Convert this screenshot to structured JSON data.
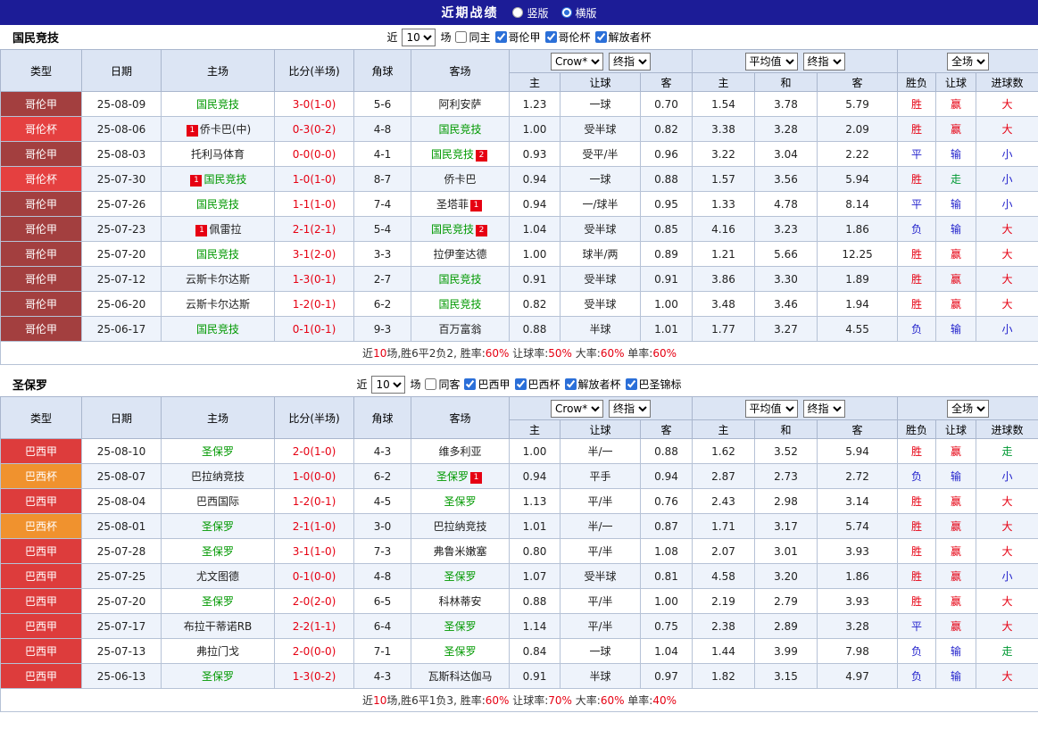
{
  "topbar": {
    "title": "近期战绩",
    "radios": [
      {
        "label": "竖版",
        "selected": false
      },
      {
        "label": "横版",
        "selected": true
      }
    ]
  },
  "colors": {
    "league": {
      "哥伦甲": "#a33f3f",
      "哥伦杯": "#e54040",
      "巴西甲": "#dd3c3c",
      "巴西杯": "#f0922e"
    },
    "result": {
      "red": "#e60012",
      "blue": "#2222cc",
      "green": "#009933"
    },
    "team": "#009900",
    "opponent": "#222222",
    "score": "#e60012",
    "summary_dark": "#333333"
  },
  "table_header": {
    "type": "类型",
    "date": "日期",
    "home": "主场",
    "score": "比分(半场)",
    "corner": "角球",
    "away": "客场",
    "odds1_selects": [
      "Crow*",
      "终指"
    ],
    "odds1_cols": [
      "主",
      "让球",
      "客"
    ],
    "odds2_selects": [
      "平均值",
      "终指"
    ],
    "odds2_cols": [
      "主",
      "和",
      "客"
    ],
    "result_select": "全场",
    "result_cols": [
      "胜负",
      "让球",
      "进球数"
    ]
  },
  "sections": [
    {
      "team": "国民竞技",
      "filter": {
        "prefix": "近",
        "games": "10",
        "suffix": "场",
        "checkboxes": [
          {
            "label": "同主",
            "checked": false
          },
          {
            "label": "哥伦甲",
            "checked": true
          },
          {
            "label": "哥伦杯",
            "checked": true
          },
          {
            "label": "解放者杯",
            "checked": true
          }
        ]
      },
      "rows": [
        {
          "league": "哥伦甲",
          "date": "25-08-09",
          "home": {
            "pre": "",
            "text": "国民竞技",
            "post": "",
            "team": true
          },
          "score": "3-0(1-0)",
          "corner": "5-6",
          "away": {
            "pre": "",
            "text": "阿利安萨",
            "post": "",
            "team": false
          },
          "odds1": [
            "1.23",
            "一球",
            "0.70"
          ],
          "odds2": [
            "1.54",
            "3.78",
            "5.79"
          ],
          "results": [
            [
              "胜",
              "red"
            ],
            [
              "赢",
              "red"
            ],
            [
              "大",
              "red"
            ]
          ]
        },
        {
          "league": "哥伦杯",
          "date": "25-08-06",
          "home": {
            "pre": "1",
            "text": "侨卡巴(中)",
            "post": "",
            "team": false
          },
          "score": "0-3(0-2)",
          "corner": "4-8",
          "away": {
            "pre": "",
            "text": "国民竞技",
            "post": "",
            "team": true
          },
          "odds1": [
            "1.00",
            "受半球",
            "0.82"
          ],
          "odds2": [
            "3.38",
            "3.28",
            "2.09"
          ],
          "results": [
            [
              "胜",
              "red"
            ],
            [
              "赢",
              "red"
            ],
            [
              "大",
              "red"
            ]
          ]
        },
        {
          "league": "哥伦甲",
          "date": "25-08-03",
          "home": {
            "pre": "",
            "text": "托利马体育",
            "post": "",
            "team": false
          },
          "score": "0-0(0-0)",
          "corner": "4-1",
          "away": {
            "pre": "",
            "text": "国民竞技",
            "post": "2",
            "team": true
          },
          "odds1": [
            "0.93",
            "受平/半",
            "0.96"
          ],
          "odds2": [
            "3.22",
            "3.04",
            "2.22"
          ],
          "results": [
            [
              "平",
              "blue"
            ],
            [
              "输",
              "blue"
            ],
            [
              "小",
              "blue"
            ]
          ]
        },
        {
          "league": "哥伦杯",
          "date": "25-07-30",
          "home": {
            "pre": "1",
            "text": "国民竞技",
            "post": "",
            "team": true
          },
          "score": "1-0(1-0)",
          "corner": "8-7",
          "away": {
            "pre": "",
            "text": "侨卡巴",
            "post": "",
            "team": false
          },
          "odds1": [
            "0.94",
            "一球",
            "0.88"
          ],
          "odds2": [
            "1.57",
            "3.56",
            "5.94"
          ],
          "results": [
            [
              "胜",
              "red"
            ],
            [
              "走",
              "green"
            ],
            [
              "小",
              "blue"
            ]
          ]
        },
        {
          "league": "哥伦甲",
          "date": "25-07-26",
          "home": {
            "pre": "",
            "text": "国民竞技",
            "post": "",
            "team": true
          },
          "score": "1-1(1-0)",
          "corner": "7-4",
          "away": {
            "pre": "",
            "text": "圣塔菲",
            "post": "1",
            "team": false
          },
          "odds1": [
            "0.94",
            "一/球半",
            "0.95"
          ],
          "odds2": [
            "1.33",
            "4.78",
            "8.14"
          ],
          "results": [
            [
              "平",
              "blue"
            ],
            [
              "输",
              "blue"
            ],
            [
              "小",
              "blue"
            ]
          ]
        },
        {
          "league": "哥伦甲",
          "date": "25-07-23",
          "home": {
            "pre": "1",
            "text": "佩雷拉",
            "post": "",
            "team": false
          },
          "score": "2-1(2-1)",
          "corner": "5-4",
          "away": {
            "pre": "",
            "text": "国民竞技",
            "post": "2",
            "team": true
          },
          "odds1": [
            "1.04",
            "受半球",
            "0.85"
          ],
          "odds2": [
            "4.16",
            "3.23",
            "1.86"
          ],
          "results": [
            [
              "负",
              "blue"
            ],
            [
              "输",
              "blue"
            ],
            [
              "大",
              "red"
            ]
          ]
        },
        {
          "league": "哥伦甲",
          "date": "25-07-20",
          "home": {
            "pre": "",
            "text": "国民竞技",
            "post": "",
            "team": true
          },
          "score": "3-1(2-0)",
          "corner": "3-3",
          "away": {
            "pre": "",
            "text": "拉伊奎达德",
            "post": "",
            "team": false
          },
          "odds1": [
            "1.00",
            "球半/两",
            "0.89"
          ],
          "odds2": [
            "1.21",
            "5.66",
            "12.25"
          ],
          "results": [
            [
              "胜",
              "red"
            ],
            [
              "赢",
              "red"
            ],
            [
              "大",
              "red"
            ]
          ]
        },
        {
          "league": "哥伦甲",
          "date": "25-07-12",
          "home": {
            "pre": "",
            "text": "云斯卡尔达斯",
            "post": "",
            "team": false
          },
          "score": "1-3(0-1)",
          "corner": "2-7",
          "away": {
            "pre": "",
            "text": "国民竞技",
            "post": "",
            "team": true
          },
          "odds1": [
            "0.91",
            "受半球",
            "0.91"
          ],
          "odds2": [
            "3.86",
            "3.30",
            "1.89"
          ],
          "results": [
            [
              "胜",
              "red"
            ],
            [
              "赢",
              "red"
            ],
            [
              "大",
              "red"
            ]
          ]
        },
        {
          "league": "哥伦甲",
          "date": "25-06-20",
          "home": {
            "pre": "",
            "text": "云斯卡尔达斯",
            "post": "",
            "team": false
          },
          "score": "1-2(0-1)",
          "corner": "6-2",
          "away": {
            "pre": "",
            "text": "国民竞技",
            "post": "",
            "team": true
          },
          "odds1": [
            "0.82",
            "受半球",
            "1.00"
          ],
          "odds2": [
            "3.48",
            "3.46",
            "1.94"
          ],
          "results": [
            [
              "胜",
              "red"
            ],
            [
              "赢",
              "red"
            ],
            [
              "大",
              "red"
            ]
          ]
        },
        {
          "league": "哥伦甲",
          "date": "25-06-17",
          "home": {
            "pre": "",
            "text": "国民竞技",
            "post": "",
            "team": true
          },
          "score": "0-1(0-1)",
          "corner": "9-3",
          "away": {
            "pre": "",
            "text": "百万富翁",
            "post": "",
            "team": false
          },
          "odds1": [
            "0.88",
            "半球",
            "1.01"
          ],
          "odds2": [
            "1.77",
            "3.27",
            "4.55"
          ],
          "results": [
            [
              "负",
              "blue"
            ],
            [
              "输",
              "blue"
            ],
            [
              "小",
              "blue"
            ]
          ]
        }
      ],
      "summary": [
        [
          "近",
          "dark"
        ],
        [
          "10",
          "red"
        ],
        [
          "场,胜6平2负2, 胜率:",
          "dark"
        ],
        [
          "60%",
          "red"
        ],
        [
          " 让球率:",
          "dark"
        ],
        [
          "50%",
          "red"
        ],
        [
          " 大率:",
          "dark"
        ],
        [
          "60%",
          "red"
        ],
        [
          " 单率:",
          "dark"
        ],
        [
          "60%",
          "red"
        ]
      ]
    },
    {
      "team": "圣保罗",
      "filter": {
        "prefix": "近",
        "games": "10",
        "suffix": "场",
        "checkboxes": [
          {
            "label": "同客",
            "checked": false
          },
          {
            "label": "巴西甲",
            "checked": true
          },
          {
            "label": "巴西杯",
            "checked": true
          },
          {
            "label": "解放者杯",
            "checked": true
          },
          {
            "label": "巴圣锦标",
            "checked": true
          }
        ]
      },
      "rows": [
        {
          "league": "巴西甲",
          "date": "25-08-10",
          "home": {
            "pre": "",
            "text": "圣保罗",
            "post": "",
            "team": true
          },
          "score": "2-0(1-0)",
          "corner": "4-3",
          "away": {
            "pre": "",
            "text": "维多利亚",
            "post": "",
            "team": false
          },
          "odds1": [
            "1.00",
            "半/一",
            "0.88"
          ],
          "odds2": [
            "1.62",
            "3.52",
            "5.94"
          ],
          "results": [
            [
              "胜",
              "red"
            ],
            [
              "赢",
              "red"
            ],
            [
              "走",
              "green"
            ]
          ]
        },
        {
          "league": "巴西杯",
          "date": "25-08-07",
          "home": {
            "pre": "",
            "text": "巴拉纳竞技",
            "post": "",
            "team": false
          },
          "score": "1-0(0-0)",
          "corner": "6-2",
          "away": {
            "pre": "",
            "text": "圣保罗",
            "post": "1",
            "team": true
          },
          "odds1": [
            "0.94",
            "平手",
            "0.94"
          ],
          "odds2": [
            "2.87",
            "2.73",
            "2.72"
          ],
          "results": [
            [
              "负",
              "blue"
            ],
            [
              "输",
              "blue"
            ],
            [
              "小",
              "blue"
            ]
          ]
        },
        {
          "league": "巴西甲",
          "date": "25-08-04",
          "home": {
            "pre": "",
            "text": "巴西国际",
            "post": "",
            "team": false
          },
          "score": "1-2(0-1)",
          "corner": "4-5",
          "away": {
            "pre": "",
            "text": "圣保罗",
            "post": "",
            "team": true
          },
          "odds1": [
            "1.13",
            "平/半",
            "0.76"
          ],
          "odds2": [
            "2.43",
            "2.98",
            "3.14"
          ],
          "results": [
            [
              "胜",
              "red"
            ],
            [
              "赢",
              "red"
            ],
            [
              "大",
              "red"
            ]
          ]
        },
        {
          "league": "巴西杯",
          "date": "25-08-01",
          "home": {
            "pre": "",
            "text": "圣保罗",
            "post": "",
            "team": true
          },
          "score": "2-1(1-0)",
          "corner": "3-0",
          "away": {
            "pre": "",
            "text": "巴拉纳竞技",
            "post": "",
            "team": false
          },
          "odds1": [
            "1.01",
            "半/一",
            "0.87"
          ],
          "odds2": [
            "1.71",
            "3.17",
            "5.74"
          ],
          "results": [
            [
              "胜",
              "red"
            ],
            [
              "赢",
              "red"
            ],
            [
              "大",
              "red"
            ]
          ]
        },
        {
          "league": "巴西甲",
          "date": "25-07-28",
          "home": {
            "pre": "",
            "text": "圣保罗",
            "post": "",
            "team": true
          },
          "score": "3-1(1-0)",
          "corner": "7-3",
          "away": {
            "pre": "",
            "text": "弗鲁米嫩塞",
            "post": "",
            "team": false
          },
          "odds1": [
            "0.80",
            "平/半",
            "1.08"
          ],
          "odds2": [
            "2.07",
            "3.01",
            "3.93"
          ],
          "results": [
            [
              "胜",
              "red"
            ],
            [
              "赢",
              "red"
            ],
            [
              "大",
              "red"
            ]
          ]
        },
        {
          "league": "巴西甲",
          "date": "25-07-25",
          "home": {
            "pre": "",
            "text": "尤文图德",
            "post": "",
            "team": false
          },
          "score": "0-1(0-0)",
          "corner": "4-8",
          "away": {
            "pre": "",
            "text": "圣保罗",
            "post": "",
            "team": true
          },
          "odds1": [
            "1.07",
            "受半球",
            "0.81"
          ],
          "odds2": [
            "4.58",
            "3.20",
            "1.86"
          ],
          "results": [
            [
              "胜",
              "red"
            ],
            [
              "赢",
              "red"
            ],
            [
              "小",
              "blue"
            ]
          ]
        },
        {
          "league": "巴西甲",
          "date": "25-07-20",
          "home": {
            "pre": "",
            "text": "圣保罗",
            "post": "",
            "team": true
          },
          "score": "2-0(2-0)",
          "corner": "6-5",
          "away": {
            "pre": "",
            "text": "科林蒂安",
            "post": "",
            "team": false
          },
          "odds1": [
            "0.88",
            "平/半",
            "1.00"
          ],
          "odds2": [
            "2.19",
            "2.79",
            "3.93"
          ],
          "results": [
            [
              "胜",
              "red"
            ],
            [
              "赢",
              "red"
            ],
            [
              "大",
              "red"
            ]
          ]
        },
        {
          "league": "巴西甲",
          "date": "25-07-17",
          "home": {
            "pre": "",
            "text": "布拉干蒂诺RB",
            "post": "",
            "team": false
          },
          "score": "2-2(1-1)",
          "corner": "6-4",
          "away": {
            "pre": "",
            "text": "圣保罗",
            "post": "",
            "team": true
          },
          "odds1": [
            "1.14",
            "平/半",
            "0.75"
          ],
          "odds2": [
            "2.38",
            "2.89",
            "3.28"
          ],
          "results": [
            [
              "平",
              "blue"
            ],
            [
              "赢",
              "red"
            ],
            [
              "大",
              "red"
            ]
          ]
        },
        {
          "league": "巴西甲",
          "date": "25-07-13",
          "home": {
            "pre": "",
            "text": "弗拉门戈",
            "post": "",
            "team": false
          },
          "score": "2-0(0-0)",
          "corner": "7-1",
          "away": {
            "pre": "",
            "text": "圣保罗",
            "post": "",
            "team": true
          },
          "odds1": [
            "0.84",
            "一球",
            "1.04"
          ],
          "odds2": [
            "1.44",
            "3.99",
            "7.98"
          ],
          "results": [
            [
              "负",
              "blue"
            ],
            [
              "输",
              "blue"
            ],
            [
              "走",
              "green"
            ]
          ]
        },
        {
          "league": "巴西甲",
          "date": "25-06-13",
          "home": {
            "pre": "",
            "text": "圣保罗",
            "post": "",
            "team": true
          },
          "score": "1-3(0-2)",
          "corner": "4-3",
          "away": {
            "pre": "",
            "text": "瓦斯科达伽马",
            "post": "",
            "team": false
          },
          "odds1": [
            "0.91",
            "半球",
            "0.97"
          ],
          "odds2": [
            "1.82",
            "3.15",
            "4.97"
          ],
          "results": [
            [
              "负",
              "blue"
            ],
            [
              "输",
              "blue"
            ],
            [
              "大",
              "red"
            ]
          ]
        }
      ],
      "summary": [
        [
          "近",
          "dark"
        ],
        [
          "10",
          "red"
        ],
        [
          "场,胜6平1负3, 胜率:",
          "dark"
        ],
        [
          "60%",
          "red"
        ],
        [
          " 让球率:",
          "dark"
        ],
        [
          "70%",
          "red"
        ],
        [
          " 大率:",
          "dark"
        ],
        [
          "60%",
          "red"
        ],
        [
          " 单率:",
          "dark"
        ],
        [
          "40%",
          "red"
        ]
      ]
    }
  ]
}
